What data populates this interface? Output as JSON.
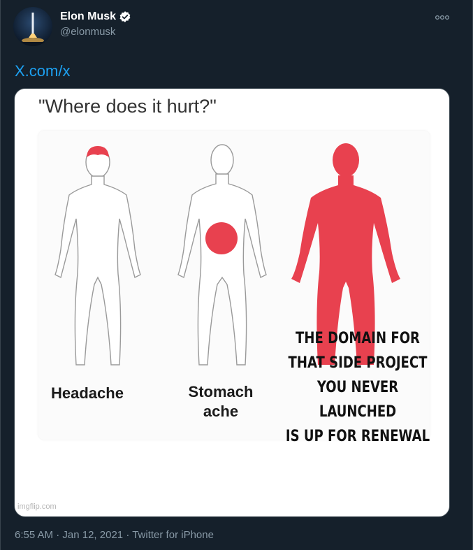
{
  "author": {
    "name": "Elon Musk",
    "handle": "@elonmusk",
    "verified": true
  },
  "tweet": {
    "text_link": "X.com/x"
  },
  "meme": {
    "title": "\"Where does it hurt?\"",
    "labels": {
      "headache": "Headache",
      "stomach_line1": "Stomach",
      "stomach_line2": "ache",
      "domain_line1": "THE DOMAIN FOR",
      "domain_line2": "THAT SIDE PROJECT",
      "domain_line3": "YOU NEVER LAUNCHED",
      "domain_line4": "IS UP FOR RENEWAL"
    },
    "watermark": "imgflip.com",
    "pain_color": "#e8414f"
  },
  "footer": {
    "time": "6:55 AM",
    "date": "Jan 12, 2021",
    "source": "Twitter for iPhone"
  },
  "colors": {
    "background": "#15202b",
    "link": "#1da1f2",
    "muted": "#8899a6"
  },
  "icons": {
    "verified": "verified-badge-icon",
    "more": "more-options-icon"
  }
}
